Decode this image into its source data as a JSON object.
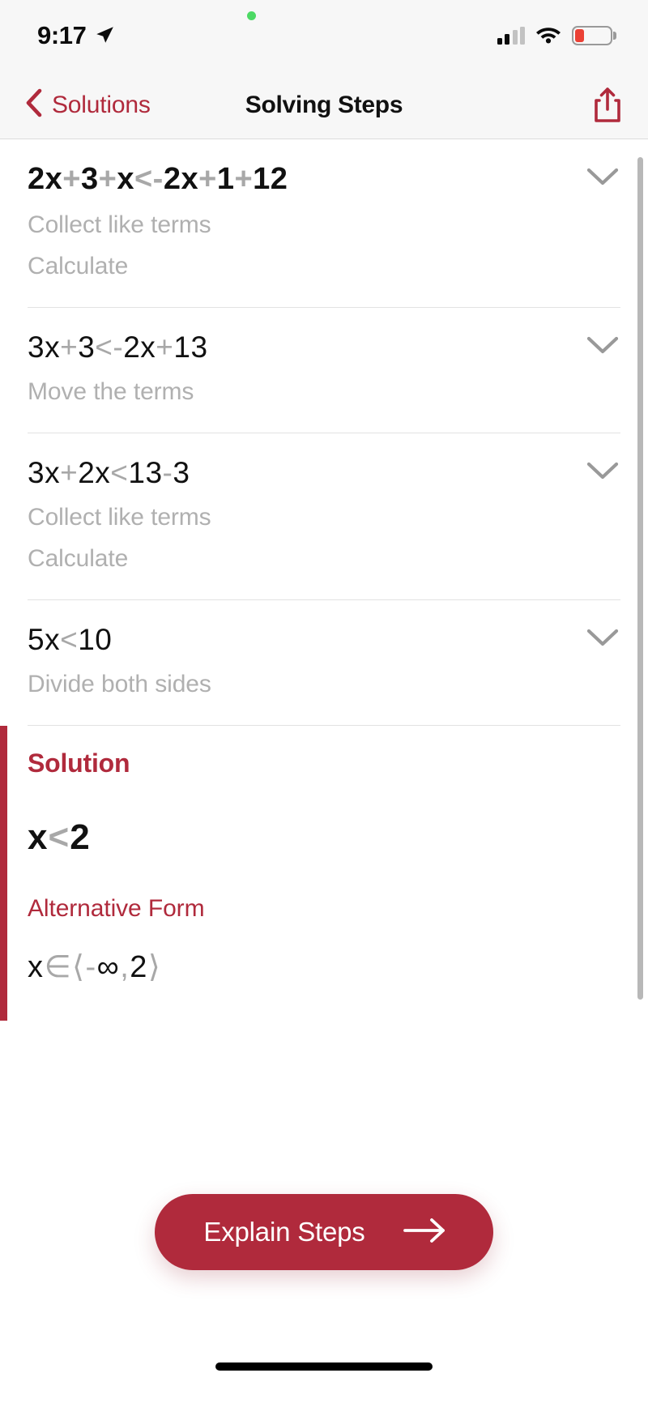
{
  "status_bar": {
    "time": "9:17",
    "location_icon": "location-arrow-icon",
    "signal_icon": "cellular-signal-icon",
    "wifi_icon": "wifi-icon",
    "battery_icon": "battery-low-icon",
    "recording_dot": "green-status-dot"
  },
  "nav": {
    "back_label": "Solutions",
    "back_icon": "chevron-left-icon",
    "title": "Solving Steps",
    "share_icon": "share-icon"
  },
  "steps": [
    {
      "expression": [
        {
          "t": "2x",
          "op": false
        },
        {
          "t": "+",
          "op": true
        },
        {
          "t": "3",
          "op": false
        },
        {
          "t": "+",
          "op": true
        },
        {
          "t": "x",
          "op": false
        },
        {
          "t": "<",
          "op": true
        },
        {
          "t": "-",
          "op": true
        },
        {
          "t": "2x",
          "op": false
        },
        {
          "t": "+",
          "op": true
        },
        {
          "t": "1",
          "op": false
        },
        {
          "t": "+",
          "op": true
        },
        {
          "t": "12",
          "op": false
        }
      ],
      "expression_text": "2x+3+x<-2x+1+12",
      "hints": [
        "Collect like terms",
        "Calculate"
      ],
      "bold": true,
      "chevron_icon": "chevron-down-icon"
    },
    {
      "expression": [
        {
          "t": "3x",
          "op": false
        },
        {
          "t": "+",
          "op": true
        },
        {
          "t": "3",
          "op": false
        },
        {
          "t": "<",
          "op": true
        },
        {
          "t": "-",
          "op": true
        },
        {
          "t": "2x",
          "op": false
        },
        {
          "t": "+",
          "op": true
        },
        {
          "t": "13",
          "op": false
        }
      ],
      "expression_text": "3x+3<-2x+13",
      "hints": [
        "Move the terms"
      ],
      "bold": false,
      "chevron_icon": "chevron-down-icon"
    },
    {
      "expression": [
        {
          "t": "3x",
          "op": false
        },
        {
          "t": "+",
          "op": true
        },
        {
          "t": "2x",
          "op": false
        },
        {
          "t": "<",
          "op": true
        },
        {
          "t": "13",
          "op": false
        },
        {
          "t": "-",
          "op": true
        },
        {
          "t": "3",
          "op": false
        }
      ],
      "expression_text": "3x+2x<13-3",
      "hints": [
        "Collect like terms",
        "Calculate"
      ],
      "bold": false,
      "chevron_icon": "chevron-down-icon"
    },
    {
      "expression": [
        {
          "t": "5x",
          "op": false
        },
        {
          "t": "<",
          "op": true
        },
        {
          "t": "10",
          "op": false
        }
      ],
      "expression_text": "5x<10",
      "hints": [
        "Divide both sides"
      ],
      "bold": false,
      "chevron_icon": "chevron-down-icon"
    }
  ],
  "solution": {
    "heading": "Solution",
    "result": [
      {
        "t": "x",
        "op": false
      },
      {
        "t": "<",
        "op": true
      },
      {
        "t": "2",
        "op": false
      }
    ],
    "result_text": "x<2",
    "alt_form_heading": "Alternative Form",
    "alt_form": [
      {
        "t": "x",
        "op": false
      },
      {
        "t": "∈",
        "op": true
      },
      {
        "t": "⟨",
        "op": true
      },
      {
        "t": "-",
        "op": true
      },
      {
        "t": "∞",
        "op": false
      },
      {
        "t": ",",
        "op": true
      },
      {
        "t": "2",
        "op": false
      },
      {
        "t": "⟩",
        "op": true
      }
    ],
    "alt_form_text": "x∈⟨-∞,2⟩",
    "accent_color": "#b02a3c"
  },
  "footer": {
    "explain_label": "Explain Steps",
    "explain_arrow_icon": "arrow-right-icon",
    "button_color": "#b02a3c"
  }
}
